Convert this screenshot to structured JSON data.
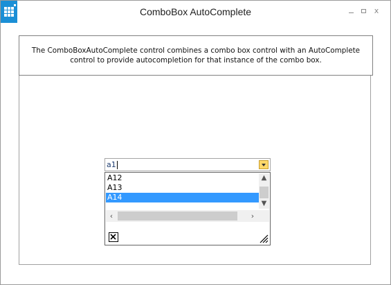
{
  "window": {
    "title": "ComboBox AutoComplete",
    "minimize_icon": "minimize-icon",
    "maximize_icon": "maximize-icon",
    "close_glyph": "x"
  },
  "description": "The ComboBoxAutoComplete control combines a combo box control with an AutoComplete control to provide autocompletion for that instance of the combo box.",
  "combo": {
    "value": "a1"
  },
  "dropdown": {
    "items": [
      {
        "label": "A12",
        "selected": false
      },
      {
        "label": "A13",
        "selected": false
      },
      {
        "label": "A14",
        "selected": true
      }
    ]
  },
  "colors": {
    "accent": "#1b8fd6",
    "selection": "#3399ff",
    "dropdown_button": "#ffd86a"
  }
}
